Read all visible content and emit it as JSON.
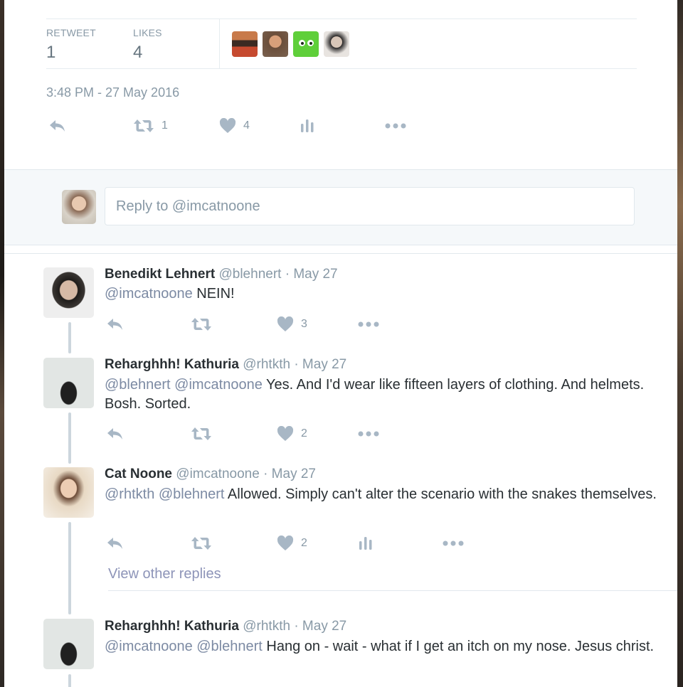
{
  "stats": {
    "retweet_label": "RETWEET",
    "retweet_value": "1",
    "likes_label": "LIKES",
    "likes_value": "4",
    "likers_count": 4
  },
  "timestamp": "3:48 PM - 27 May 2016",
  "main_actions": {
    "retweet_count": "1",
    "like_count": "4"
  },
  "reply": {
    "placeholder": "Reply to @imcatnoone"
  },
  "tweets": [
    {
      "name": "Benedikt Lehnert",
      "meta": "@blehnert · May 27",
      "mentions": "@imcatnoone",
      "text": " NEIN!",
      "retweet_count": "",
      "like_count": "3"
    },
    {
      "name": "Reharghhh! Kathuria",
      "meta": "@rhtkth · May 27",
      "mentions": "@blehnert @imcatnoone",
      "text": " Yes. And I'd wear like fifteen layers of clothing. And helmets. Bosh. Sorted.",
      "retweet_count": "",
      "like_count": "2"
    },
    {
      "name": "Cat Noone",
      "meta": "@imcatnoone · May 27",
      "mentions": "@rhtkth @blehnert",
      "text": " Allowed. Simply can't alter the scenario with the snakes themselves.",
      "retweet_count": "",
      "like_count": "2"
    },
    {
      "name": "Reharghhh! Kathuria",
      "meta": "@rhtkth · May 27",
      "mentions": "@imcatnoone @blehnert",
      "text": " Hang on - wait - what if I get an itch on my nose. Jesus christ."
    }
  ],
  "view_other_replies": "View other replies",
  "colors": {
    "icon": "#a8b7c5",
    "mention": "#7c8aa3",
    "thread_line": "#ccd6dd"
  }
}
